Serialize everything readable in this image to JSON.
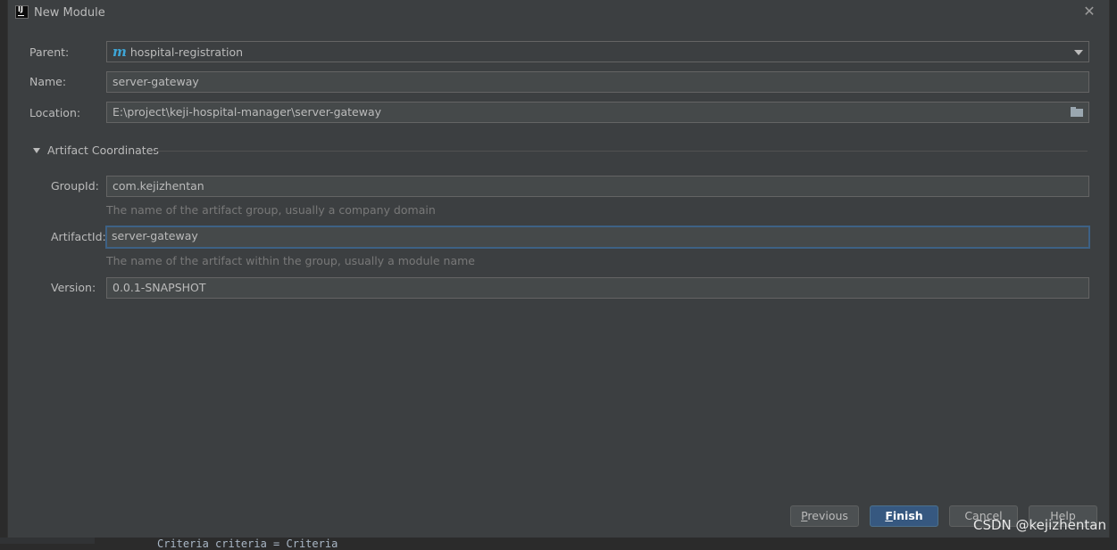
{
  "window": {
    "title": "New Module",
    "app_icon_text": "IJ"
  },
  "form": {
    "parent": {
      "label": "Parent:",
      "value": "hospital-registration"
    },
    "name": {
      "label": "Name:",
      "value": "server-gateway"
    },
    "location": {
      "label": "Location:",
      "value": "E:\\project\\keji-hospital-manager\\server-gateway"
    }
  },
  "artifact": {
    "section_title": "Artifact Coordinates",
    "group_id": {
      "label": "GroupId:",
      "value": "com.kejizhentan",
      "hint": "The name of the artifact group, usually a company domain"
    },
    "artifact_id": {
      "label": "ArtifactId:",
      "value": "server-gateway",
      "hint": "The name of the artifact within the group, usually a module name"
    },
    "version": {
      "label": "Version:",
      "value": "0.0.1-SNAPSHOT"
    }
  },
  "buttons": {
    "previous": {
      "mnemonic": "P",
      "rest": "revious"
    },
    "finish": {
      "mnemonic": "F",
      "rest": "inish"
    },
    "cancel": "Cancel",
    "help": "Help"
  },
  "watermark": "CSDN @kejizhentan",
  "background_code": "Criteria criteria = Criteria",
  "colors": {
    "dialog_bg": "#3c3f41",
    "field_bg": "#45494a",
    "focus_border": "#3d6185",
    "primary_button": "#365880",
    "maven_icon": "#3ea5d6"
  },
  "icons": {
    "close": "close-icon",
    "parent": "maven-module-icon",
    "location": "folder-icon",
    "section_toggle": "triangle-down-icon"
  }
}
